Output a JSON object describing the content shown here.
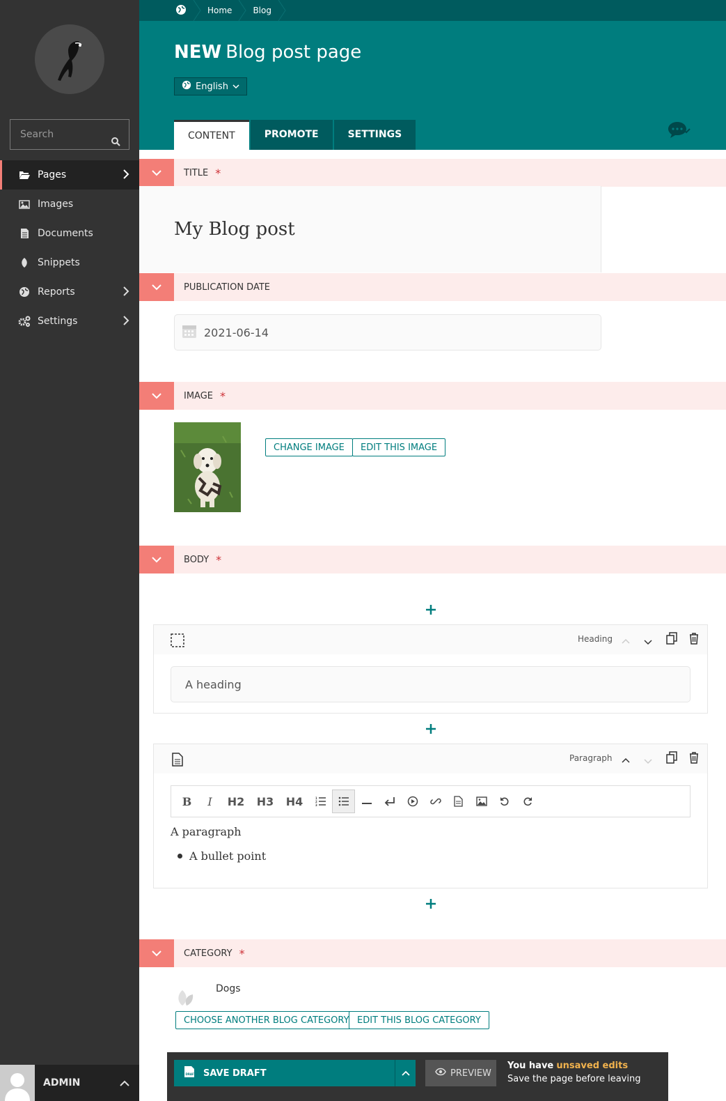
{
  "sidebar": {
    "search_placeholder": "Search",
    "items": [
      {
        "label": "Pages",
        "icon": "folder-open-icon",
        "active": true,
        "has_children": true
      },
      {
        "label": "Images",
        "icon": "image-icon",
        "active": false,
        "has_children": false
      },
      {
        "label": "Documents",
        "icon": "doc-icon",
        "active": false,
        "has_children": false
      },
      {
        "label": "Snippets",
        "icon": "snippet-icon",
        "active": false,
        "has_children": false
      },
      {
        "label": "Reports",
        "icon": "globe-icon",
        "active": false,
        "has_children": true
      },
      {
        "label": "Settings",
        "icon": "cogs-icon",
        "active": false,
        "has_children": true
      }
    ],
    "user": "ADMIN"
  },
  "header": {
    "breadcrumbs": [
      "Home",
      "Blog"
    ],
    "title_prefix": "NEW",
    "title": "Blog post page",
    "locale": "English",
    "tabs": [
      {
        "label": "CONTENT",
        "active": true
      },
      {
        "label": "PROMOTE",
        "active": false
      },
      {
        "label": "SETTINGS",
        "active": false
      }
    ]
  },
  "sections": {
    "title": {
      "label": "TITLE",
      "required": "*",
      "value": "My Blog post"
    },
    "pub_date": {
      "label": "PUBLICATION DATE",
      "value": "2021-06-14"
    },
    "image": {
      "label": "IMAGE",
      "required": "*",
      "change": "CHANGE IMAGE",
      "edit": "EDIT THIS IMAGE"
    },
    "body": {
      "label": "BODY",
      "required": "*",
      "heading_block": {
        "type": "Heading",
        "placeholder": "A heading"
      },
      "paragraph_block": {
        "type": "Paragraph",
        "toolbar": [
          "B",
          "I",
          "H2",
          "H3",
          "H4",
          "ordered-list",
          "bullet-list",
          "hr",
          "line-break",
          "embed",
          "link",
          "document",
          "image",
          "undo",
          "redo"
        ],
        "text": "A paragraph",
        "bullet": "A bullet point"
      }
    },
    "category": {
      "label": "CATEGORY",
      "required": "*",
      "value": "Dogs",
      "choose": "CHOOSE ANOTHER BLOG CATEGORY",
      "edit": "EDIT THIS BLOG CATEGORY"
    }
  },
  "footer": {
    "save": "SAVE DRAFT",
    "preview": "PREVIEW",
    "notice_prefix": "You have",
    "notice_highlight": "unsaved edits",
    "notice_sub": "Save the page before leaving"
  },
  "colors": {
    "teal": "#007d7e",
    "dark_teal": "#005b5e",
    "salmon": "#f37e77",
    "pink": "#fdeceb",
    "sidebar": "#333333"
  }
}
